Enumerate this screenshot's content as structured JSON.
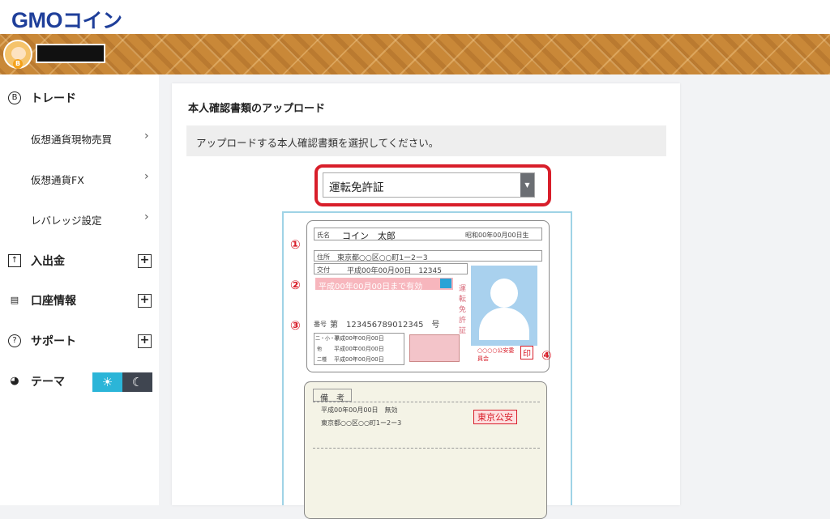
{
  "brand": {
    "logo_text": "GMO",
    "logo_kana": "コイン"
  },
  "sidebar": {
    "trade": {
      "label": "トレード",
      "icon": "bitcoin-icon"
    },
    "trade_items": [
      {
        "label": "仮想通貨現物売買"
      },
      {
        "label": "仮想通貨FX"
      },
      {
        "label": "レバレッジ設定"
      }
    ],
    "deposit": {
      "label": "入出金",
      "icon": "deposit-icon"
    },
    "account": {
      "label": "口座情報",
      "icon": "account-icon"
    },
    "support": {
      "label": "サポート",
      "icon": "help-icon"
    },
    "theme": {
      "label": "テーマ",
      "icon": "palette-icon",
      "light_icon": "sun-icon",
      "dark_icon": "moon-icon"
    }
  },
  "main": {
    "title": "本人確認書類のアップロード",
    "notice": "アップロードする本人確認書類を選択してください。",
    "document_type": {
      "selected": "運転免許証"
    }
  },
  "license": {
    "name_label": "氏名",
    "name": "コイン　太郎",
    "birth": "昭和00年00月00日生",
    "address_label": "住所",
    "address": "東京都○○区○○町1ー2ー3",
    "issue_label": "交付",
    "issue": "平成00年00月00日　12345",
    "validity": "平成00年00月00日まで有効",
    "license_type": "運転免許証",
    "number_label": "番号",
    "number": "第　123456789012345　号",
    "dates": [
      "平成00年00月00日",
      "平成00年00月00日",
      "平成00年00月00日"
    ],
    "date_labels": [
      "二・小・原",
      "他",
      "二種"
    ],
    "authority": "○○○○公安委員会",
    "seal": "印",
    "markers": [
      "①",
      "②",
      "③",
      "④"
    ],
    "back_title": "備　考",
    "back_line1": "平成00年00月00日　無効",
    "back_line2": "東京都○○区○○町1ー2ー3",
    "back_stamp": "東京公安"
  },
  "colors": {
    "brand": "#1f3f9a",
    "highlight": "#d81e2a",
    "toggle_light": "#2bb5d8",
    "toggle_dark": "#3f4550"
  }
}
